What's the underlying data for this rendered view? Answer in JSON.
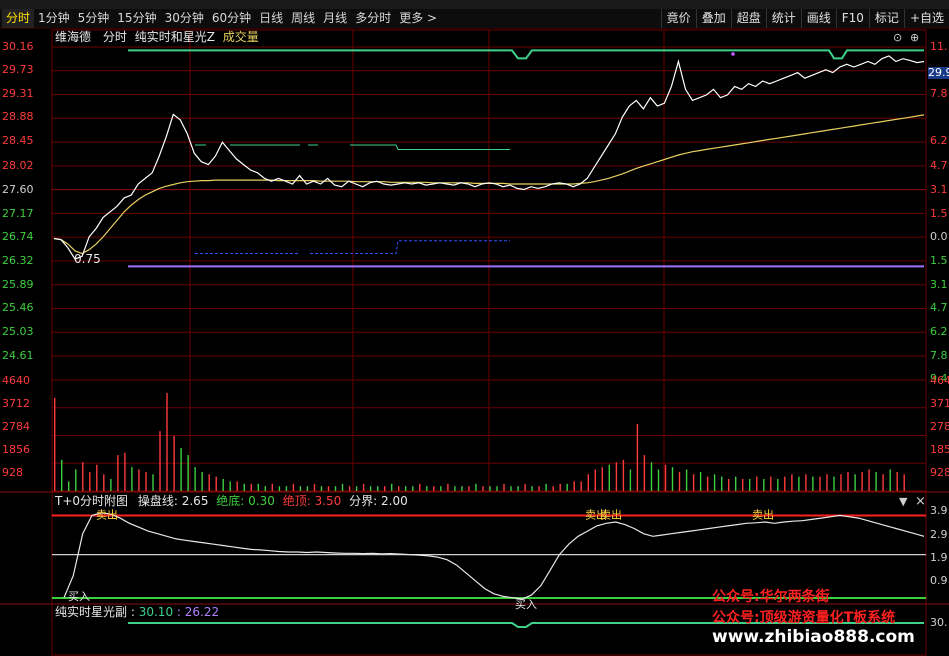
{
  "toolbar": {
    "periods": [
      "分时",
      "1分钟",
      "5分钟",
      "15分钟",
      "30分钟",
      "60分钟",
      "日线",
      "周线",
      "月线",
      "多分时",
      "更多 >"
    ],
    "active_period": 0,
    "right_tools": [
      "竟价",
      "叠加",
      "超盘",
      "统计",
      "画线",
      "F10",
      "标记",
      "+自选"
    ]
  },
  "header": {
    "stock_name": "维海德",
    "mode": "分时",
    "indicator_name": "纯实时和星光Z",
    "volume_label": "成交量"
  },
  "price_axis": {
    "left_labels": [
      "30.16",
      "29.73",
      "29.31",
      "28.88",
      "28.45",
      "28.02",
      "27.60",
      "27.17",
      "26.74",
      "26.32",
      "25.89",
      "25.46",
      "25.03",
      "24.61"
    ],
    "right_labels": [
      "11.",
      "7.8",
      "6.2",
      "4.7",
      "3.1",
      "1.5",
      "0.0",
      "1.5",
      "3.1",
      "4.7",
      "6.2",
      "7.8",
      "9.4"
    ],
    "right_label_colors": [
      "#ff3b3b",
      "#ff3b3b",
      "#ff3b3b",
      "#ff3b3b",
      "#ff3b3b",
      "#ff3b3b",
      "#d0d0d0",
      "#3ecf3e",
      "#3ecf3e",
      "#3ecf3e",
      "#3ecf3e",
      "#3ecf3e",
      "#3ecf3e"
    ],
    "current_price_tag": "29.9",
    "low_marker": "0.75"
  },
  "volume_axis": {
    "left_labels": [
      "4640",
      "3712",
      "2784",
      "1856",
      "928"
    ],
    "right_labels": [
      "464",
      "371",
      "278",
      "185",
      "928"
    ]
  },
  "indicator_panel": {
    "title": "T+0分时附图",
    "line_label": "操盘线:",
    "line_value": "2.65",
    "bottom_label": "绝底:",
    "bottom_value": "0.30",
    "top_label": "绝顶:",
    "top_value": "3.50",
    "boundary_label": "分界:",
    "boundary_value": "2.00",
    "axis_labels": [
      "3.9",
      "2.9",
      "1.9",
      "0.9"
    ],
    "signals": [
      "卖出",
      "买入",
      "卖出",
      "卖出",
      "买入",
      "卖出"
    ],
    "dropdown_glyph": "▼",
    "close_glyph": "×"
  },
  "sub_panel": {
    "title": "纯实时星光副",
    "value1": "30.10",
    "value2": "26.22",
    "axis_label": "30."
  },
  "watermarks": {
    "line1": "公众号:华尔两条街",
    "line2": "公众号:顶级游资量化T板系统",
    "line3": "www.zhibiao888.com"
  },
  "colors": {
    "price_line": "#ffffff",
    "avg_line": "#e8d060",
    "grid": "#6a0000",
    "up": "#ff3b3b",
    "down": "#3ecf3e",
    "accent_green": "#3fd08a",
    "purple": "#a070ff"
  },
  "chart_data": {
    "type": "line",
    "title": "",
    "price_range": [
      24.61,
      30.16
    ],
    "price_series": [
      26.72,
      26.7,
      26.55,
      26.35,
      26.4,
      26.75,
      26.9,
      27.1,
      27.2,
      27.3,
      27.45,
      27.5,
      27.7,
      27.8,
      27.9,
      28.2,
      28.55,
      28.95,
      28.85,
      28.6,
      28.25,
      28.1,
      28.05,
      28.2,
      28.45,
      28.3,
      28.15,
      28.05,
      27.95,
      27.9,
      27.8,
      27.75,
      27.8,
      27.75,
      27.7,
      27.85,
      27.7,
      27.75,
      27.7,
      27.8,
      27.68,
      27.65,
      27.75,
      27.7,
      27.65,
      27.72,
      27.75,
      27.7,
      27.68,
      27.7,
      27.72,
      27.7,
      27.72,
      27.68,
      27.7,
      27.72,
      27.7,
      27.68,
      27.72,
      27.7,
      27.65,
      27.7,
      27.72,
      27.7,
      27.65,
      27.68,
      27.62,
      27.6,
      27.65,
      27.62,
      27.65,
      27.7,
      27.72,
      27.7,
      27.65,
      27.7,
      27.8,
      28.0,
      28.2,
      28.4,
      28.6,
      28.9,
      29.1,
      29.2,
      29.05,
      29.25,
      29.1,
      29.15,
      29.45,
      29.9,
      29.4,
      29.2,
      29.25,
      29.3,
      29.4,
      29.25,
      29.3,
      29.45,
      29.4,
      29.5,
      29.45,
      29.55,
      29.5,
      29.55,
      29.6,
      29.65,
      29.7,
      29.6,
      29.65,
      29.7,
      29.75,
      29.7,
      29.8,
      29.85,
      29.8,
      29.85,
      29.9,
      29.85,
      29.95,
      30.0,
      29.9,
      29.95,
      29.92,
      29.88,
      29.9
    ],
    "avg_series": [
      26.72,
      26.7,
      26.62,
      26.5,
      26.45,
      26.52,
      26.62,
      26.75,
      26.9,
      27.05,
      27.2,
      27.32,
      27.42,
      27.5,
      27.56,
      27.62,
      27.66,
      27.69,
      27.72,
      27.74,
      27.75,
      27.76,
      27.76,
      27.77,
      27.77,
      27.77,
      27.77,
      27.77,
      27.77,
      27.77,
      27.77,
      27.77,
      27.76,
      27.76,
      27.76,
      27.76,
      27.76,
      27.76,
      27.75,
      27.75,
      27.75,
      27.75,
      27.75,
      27.74,
      27.74,
      27.74,
      27.74,
      27.74,
      27.73,
      27.73,
      27.73,
      27.73,
      27.73,
      27.73,
      27.72,
      27.72,
      27.72,
      27.72,
      27.72,
      27.72,
      27.71,
      27.71,
      27.71,
      27.71,
      27.71,
      27.7,
      27.7,
      27.7,
      27.7,
      27.7,
      27.7,
      27.7,
      27.7,
      27.7,
      27.7,
      27.71,
      27.72,
      27.74,
      27.77,
      27.8,
      27.84,
      27.88,
      27.93,
      27.98,
      28.02,
      28.06,
      28.1,
      28.14,
      28.18,
      28.22,
      28.25,
      28.28,
      28.3,
      28.32,
      28.34,
      28.36,
      28.38,
      28.4,
      28.42,
      28.44,
      28.46,
      28.48,
      28.5,
      28.52,
      28.54,
      28.56,
      28.58,
      28.6,
      28.62,
      28.64,
      28.66,
      28.68,
      28.7,
      28.72,
      28.74,
      28.76,
      28.78,
      28.8,
      28.82,
      28.84,
      28.86,
      28.88,
      28.9,
      28.92,
      28.94
    ],
    "volume_range": [
      0,
      4640
    ],
    "volume": [
      3900,
      1300,
      400,
      900,
      1200,
      800,
      1100,
      700,
      500,
      1500,
      1600,
      1000,
      900,
      800,
      700,
      2500,
      4100,
      2300,
      1800,
      1500,
      1000,
      800,
      700,
      600,
      500,
      400,
      400,
      300,
      300,
      300,
      200,
      300,
      200,
      200,
      300,
      200,
      200,
      300,
      200,
      200,
      200,
      300,
      200,
      200,
      300,
      200,
      200,
      200,
      300,
      200,
      200,
      200,
      300,
      200,
      200,
      200,
      300,
      200,
      200,
      200,
      300,
      200,
      200,
      200,
      300,
      200,
      200,
      300,
      200,
      200,
      300,
      200,
      300,
      300,
      400,
      400,
      700,
      900,
      1000,
      1100,
      1200,
      1300,
      900,
      2800,
      1500,
      1200,
      900,
      1100,
      1000,
      800,
      900,
      700,
      800,
      600,
      700,
      600,
      500,
      600,
      500,
      500,
      600,
      500,
      600,
      500,
      600,
      700,
      600,
      700,
      600,
      600,
      700,
      600,
      700,
      800,
      700,
      800,
      900,
      800,
      700,
      900,
      800,
      700
    ],
    "volume_up": [
      1,
      0,
      0,
      0,
      1,
      1,
      1,
      1,
      0,
      1,
      1,
      0,
      1,
      1,
      0,
      1,
      1,
      1,
      0,
      0,
      0,
      0,
      1,
      1,
      0,
      0,
      1,
      0,
      1,
      0,
      0,
      1,
      0,
      0,
      1,
      0,
      0,
      1,
      0,
      1,
      0,
      0,
      1,
      0,
      1,
      0,
      0,
      1,
      0,
      1,
      0,
      0,
      1,
      0,
      1,
      0,
      1,
      0,
      0,
      1,
      0,
      1,
      0,
      0,
      1,
      0,
      0,
      1,
      0,
      1,
      0,
      1,
      1,
      0,
      1,
      1,
      1,
      1,
      1,
      0,
      1,
      1,
      0,
      1,
      1,
      0,
      0,
      1,
      0,
      1,
      0,
      1,
      0,
      1,
      0,
      0,
      1,
      0,
      1,
      0,
      1,
      0,
      1,
      0,
      1,
      1,
      0,
      1,
      0,
      1,
      1,
      0,
      1,
      1,
      0,
      1,
      1,
      0,
      1,
      0,
      1,
      1,
      0,
      1
    ],
    "indicator_range": [
      0.3,
      3.9
    ],
    "indicator_series": [
      0.35,
      1.2,
      2.8,
      3.5,
      3.6,
      3.55,
      3.4,
      3.2,
      3.05,
      2.9,
      2.8,
      2.7,
      2.6,
      2.55,
      2.5,
      2.45,
      2.4,
      2.35,
      2.3,
      2.25,
      2.2,
      2.18,
      2.15,
      2.12,
      2.1,
      2.1,
      2.08,
      2.1,
      2.08,
      2.06,
      2.05,
      2.05,
      2.04,
      2.05,
      2.03,
      2.04,
      2.02,
      2.0,
      1.98,
      1.95,
      1.9,
      1.8,
      1.6,
      1.3,
      1.0,
      0.7,
      0.5,
      0.4,
      0.35,
      0.3,
      0.45,
      0.8,
      1.4,
      2.0,
      2.4,
      2.7,
      2.9,
      3.1,
      3.2,
      3.25,
      3.15,
      3.0,
      2.8,
      2.7,
      2.75,
      2.8,
      2.85,
      2.9,
      2.95,
      3.0,
      3.05,
      3.1,
      3.15,
      3.2,
      3.22,
      3.25,
      3.2,
      3.25,
      3.28,
      3.3,
      3.35,
      3.4,
      3.45,
      3.5,
      3.45,
      3.4,
      3.3,
      3.2,
      3.1,
      3.0,
      2.9,
      2.8,
      2.7
    ],
    "indicator_levels": {
      "top": 3.5,
      "bottom": 0.3,
      "boundary": 2.0
    }
  }
}
